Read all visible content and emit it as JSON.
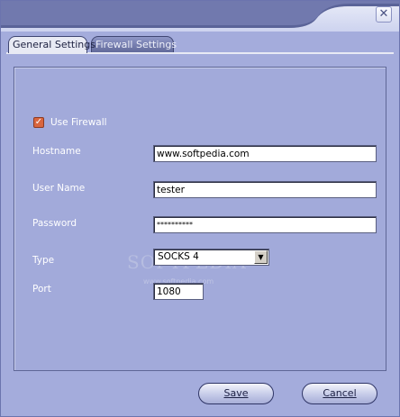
{
  "window": {
    "close_glyph": "✕"
  },
  "tabs": [
    {
      "label": "General Settings",
      "active": true
    },
    {
      "label": "Firewall Settings",
      "active": false
    }
  ],
  "form": {
    "use_firewall": {
      "label": "Use Firewall",
      "checked": true
    },
    "hostname": {
      "label": "Hostname",
      "value": "www.softpedia.com"
    },
    "username": {
      "label": "User Name",
      "value": "tester"
    },
    "password": {
      "label": "Password",
      "value": "**********"
    },
    "type": {
      "label": "Type",
      "value": "SOCKS 4"
    },
    "port": {
      "label": "Port",
      "value": "1080"
    }
  },
  "watermark": {
    "text": "SOFTPEDIA",
    "sub": "www.softpedia.com"
  },
  "buttons": {
    "save": "Save",
    "cancel": "Cancel"
  },
  "colors": {
    "background": "#A4ACDC",
    "accent": "#2F3566",
    "checkbox": "#D9663E"
  }
}
